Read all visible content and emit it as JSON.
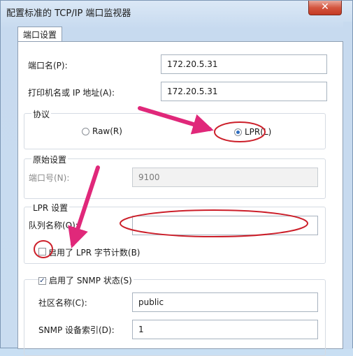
{
  "window": {
    "title": "配置标准的 TCP/IP 端口监视器",
    "close_glyph": "✕"
  },
  "tab": {
    "label": "端口设置"
  },
  "port": {
    "label": "端口名(P):",
    "value": "172.20.5.31"
  },
  "printer": {
    "label": "打印机名或 IP 地址(A):",
    "value": "172.20.5.31"
  },
  "protocol": {
    "title": "协议",
    "raw_label": "Raw(R)",
    "lpr_label": "LPR(L)",
    "selected": "LPR"
  },
  "raw_settings": {
    "title": "原始设置",
    "port_label": "端口号(N):",
    "port_value": "9100"
  },
  "lpr_settings": {
    "title": "LPR 设置",
    "queue_label": "队列名称(Q):",
    "queue_value": "",
    "byte_count_label": "启用了 LPR 字节计数(B)",
    "byte_count_checked": false
  },
  "snmp": {
    "enabled_label": "启用了 SNMP 状态(S)",
    "enabled": true,
    "community_label": "社区名称(C):",
    "community_value": "public",
    "index_label": "SNMP 设备索引(D):",
    "index_value": "1"
  },
  "annotation_color": "#e0287a",
  "circle_color": "#cc1f2a"
}
